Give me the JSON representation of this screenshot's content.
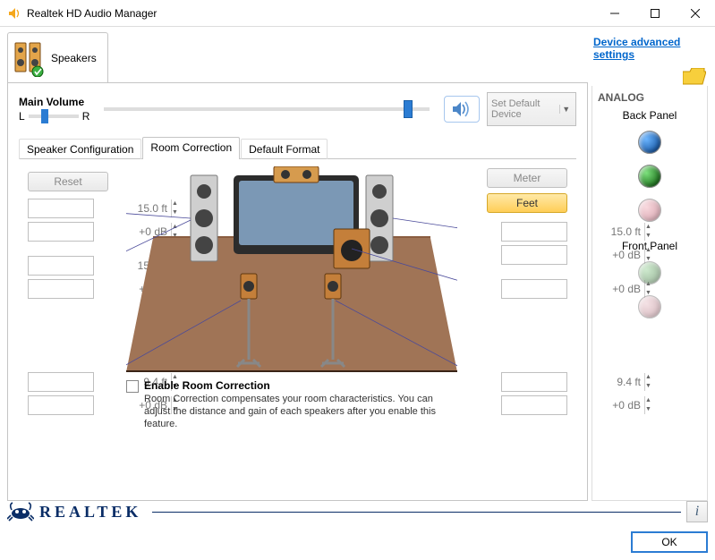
{
  "window": {
    "title": "Realtek HD Audio Manager"
  },
  "device_tab": {
    "label": "Speakers"
  },
  "main_volume": {
    "label": "Main Volume",
    "left": "L",
    "right": "R",
    "balance_pos_pct": 28,
    "volume_pos_pct": 92
  },
  "set_default": {
    "label": "Set Default Device"
  },
  "subtabs": {
    "config": "Speaker Configuration",
    "room": "Room Correction",
    "format": "Default Format"
  },
  "room": {
    "reset": "Reset",
    "meter": "Meter",
    "feet": "Feet",
    "left_top": {
      "dist": "15.0 ft",
      "gain": "+0 dB"
    },
    "left_mid": {
      "dist": "15.0 ft",
      "gain": "+0 dB"
    },
    "left_bot": {
      "dist": "9.4 ft",
      "gain": "+0 dB"
    },
    "right_top": {
      "dist": "15.0 ft",
      "gain": "+0 dB"
    },
    "right_mid": {
      "gain": "+0 dB"
    },
    "right_bot": {
      "dist": "9.4 ft",
      "gain": "+0 dB"
    },
    "enable_title": "Enable Room Correction",
    "enable_desc": "Room Correction compensates your room characteristics. You can adjust the distance and gain of each speakers after you enable this feature."
  },
  "right_panel": {
    "adv_link": "Device advanced settings",
    "analog": "ANALOG",
    "back": "Back Panel",
    "front": "Front Panel"
  },
  "footer": {
    "brand": "REALTEK",
    "ok": "OK"
  }
}
